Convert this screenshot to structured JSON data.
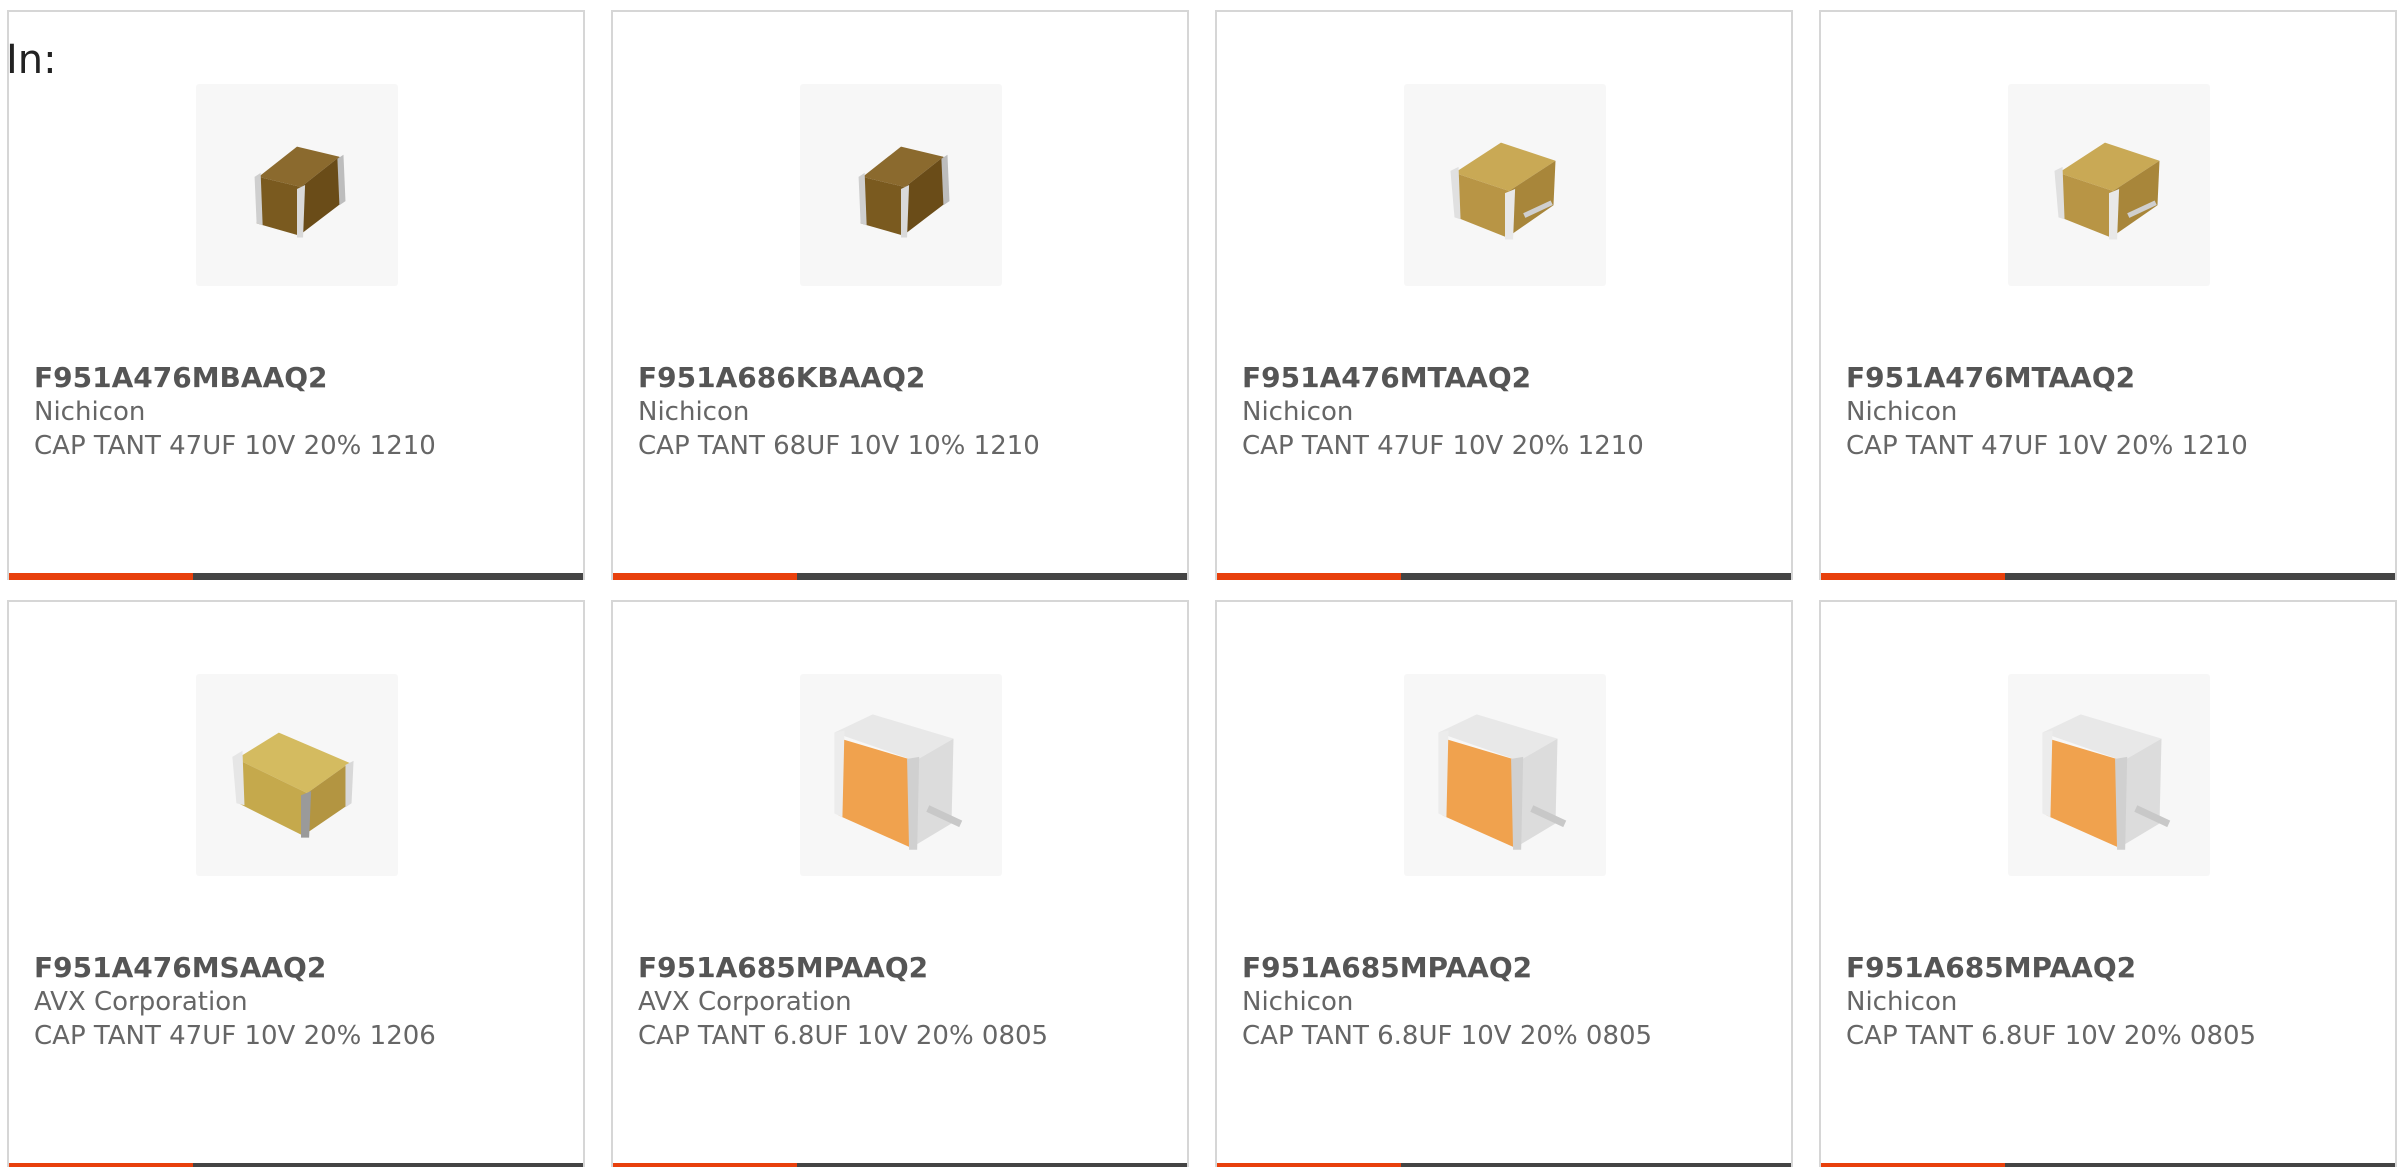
{
  "page": {
    "in_label": "In:"
  },
  "colors": {
    "accent_bar": "#e8400c",
    "bar_track": "#444444",
    "card_border": "#d6d6d6"
  },
  "products": [
    {
      "part_number": "F951A476MBAAQ2",
      "manufacturer": "Nichicon",
      "description": "CAP TANT 47UF 10V 20% 1210",
      "image_icon": "tantalum-capacitor-brown-icon"
    },
    {
      "part_number": "F951A686KBAAQ2",
      "manufacturer": "Nichicon",
      "description": "CAP TANT 68UF 10V 10% 1210",
      "image_icon": "tantalum-capacitor-brown-icon"
    },
    {
      "part_number": "F951A476MTAAQ2",
      "manufacturer": "Nichicon",
      "description": "CAP TANT 47UF 10V 20% 1210",
      "image_icon": "tantalum-capacitor-tan-icon"
    },
    {
      "part_number": "F951A476MTAAQ2",
      "manufacturer": "Nichicon",
      "description": "CAP TANT 47UF 10V 20% 1210",
      "image_icon": "tantalum-capacitor-tan-icon"
    },
    {
      "part_number": "F951A476MSAAQ2",
      "manufacturer": "AVX Corporation",
      "description": "CAP TANT 47UF 10V 20% 1206",
      "image_icon": "tantalum-capacitor-yellow-icon"
    },
    {
      "part_number": "F951A685MPAAQ2",
      "manufacturer": "AVX Corporation",
      "description": "CAP TANT 6.8UF 10V 20% 0805",
      "image_icon": "tantalum-capacitor-orange-icon"
    },
    {
      "part_number": "F951A685MPAAQ2",
      "manufacturer": "Nichicon",
      "description": "CAP TANT 6.8UF 10V 20% 0805",
      "image_icon": "tantalum-capacitor-orange-icon"
    },
    {
      "part_number": "F951A685MPAAQ2",
      "manufacturer": "Nichicon",
      "description": "CAP TANT 6.8UF 10V 20% 0805",
      "image_icon": "tantalum-capacitor-orange-icon"
    }
  ]
}
